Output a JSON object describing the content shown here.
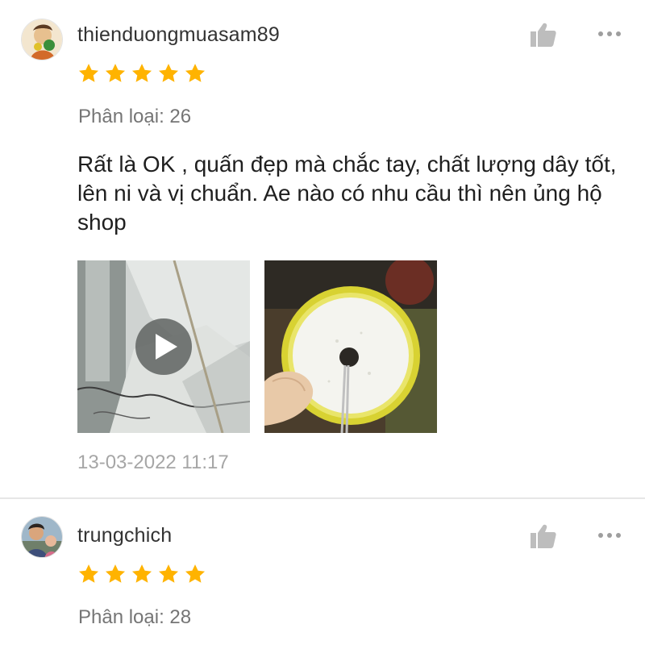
{
  "reviews": [
    {
      "username": "thienduongmuasam89",
      "rating": 5,
      "variation": "Phân loại: 26",
      "comment": "Rất là OK , quấn đẹp mà chắc tay, chất lượng dây tốt, lên ni và vị chuẩn. Ae nào có nhu cầu thì nên ủng hộ shop",
      "timestamp": "13-03-2022 11:17",
      "media": [
        "video-thumbnail",
        "photo-thumbnail"
      ]
    },
    {
      "username": "trungchich",
      "rating": 5,
      "variation": "Phân loại: 28"
    }
  ],
  "icons": {
    "like": "thumbs-up-icon",
    "more": "more-options-icon",
    "star": "star-icon",
    "play": "play-icon"
  },
  "colors": {
    "star": "#ffb300",
    "icon_gray": "#bdbdbd",
    "text_secondary": "#757575",
    "timestamp": "#a6a6a6"
  }
}
